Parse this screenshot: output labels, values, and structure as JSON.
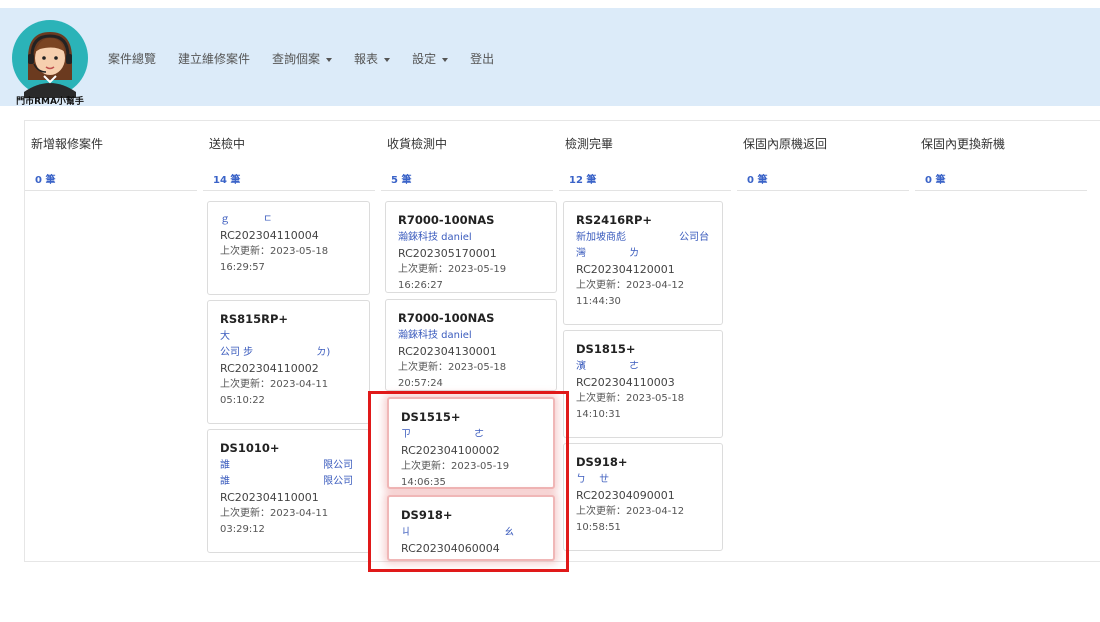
{
  "header": {
    "logo_text": "門市RMA小幫手",
    "nav": [
      {
        "label": "案件總覽"
      },
      {
        "label": "建立維修案件"
      },
      {
        "label": "查詢個案"
      },
      {
        "label": "報表"
      },
      {
        "label": "設定"
      },
      {
        "label": "登出"
      }
    ]
  },
  "columns": [
    {
      "title": "新增報修案件",
      "count": "0 筆"
    },
    {
      "title": "送檢中",
      "count": "14 筆"
    },
    {
      "title": "收貨檢測中",
      "count": "5 筆"
    },
    {
      "title": "檢測完畢",
      "count": "12 筆"
    },
    {
      "title": "保固內原機返回",
      "count": "0 筆"
    },
    {
      "title": "保固內更換新機",
      "count": "0 筆"
    }
  ],
  "cards": {
    "c1": [
      {
        "model": "",
        "company": "ｇ　　　 ㄷ",
        "rc": "RC202304110004",
        "updated": "上次更新：2023-05-18 16:29:57"
      },
      {
        "model": "RS815RP+",
        "company": "大　　　　　　　　　　　　　 公司 步　　　　　　 ㄉ)",
        "rc": "RC202304110002",
        "updated": "上次更新：2023-04-11 05:10:22"
      },
      {
        "model": "DS1010+",
        "company": "誰　　　　　　　　　 限公司 誰　　　　　　　　　 限公司",
        "rc": "RC202304110001",
        "updated": "上次更新：2023-04-11 03:29:12"
      }
    ],
    "c2": [
      {
        "model": "R7000-100NAS",
        "company": "瀚錸科技 daniel",
        "rc": "RC202305170001",
        "updated": "上次更新：2023-05-19 16:26:27"
      },
      {
        "model": "R7000-100NAS",
        "company": "瀚錸科技 daniel",
        "rc": "RC202304130001",
        "updated": "上次更新：2023-05-18 20:57:24"
      },
      {
        "model": "DS1515+",
        "company": "ㄗ　　　　　　 ㄜ",
        "rc": "RC202304100002",
        "updated": "上次更新：2023-05-19 14:06:35"
      },
      {
        "model": "DS918+",
        "company": "ㄐ　　　　　　　　　 ㄠ",
        "rc": "RC202304060004",
        "updated": ""
      }
    ],
    "c3": [
      {
        "model": "RS2416RP+",
        "company": "新加坡商彪　　　　　 公司台 灣　　　　 ㄌ",
        "rc": "RC202304120001",
        "updated": "上次更新：2023-04-12 11:44:30"
      },
      {
        "model": "DS1815+",
        "company": "濱　　　　 ㄜ",
        "rc": "RC202304110003",
        "updated": "上次更新：2023-05-18 14:10:31"
      },
      {
        "model": "DS918+",
        "company": "ㄅ　 ㄝ",
        "rc": "RC202304090001",
        "updated": "上次更新：2023-04-12 10:58:51"
      }
    ]
  },
  "colors": {
    "navbar_bg": "#dcebf9",
    "count_blue": "#3a63c8",
    "highlight_red": "#e01919"
  }
}
